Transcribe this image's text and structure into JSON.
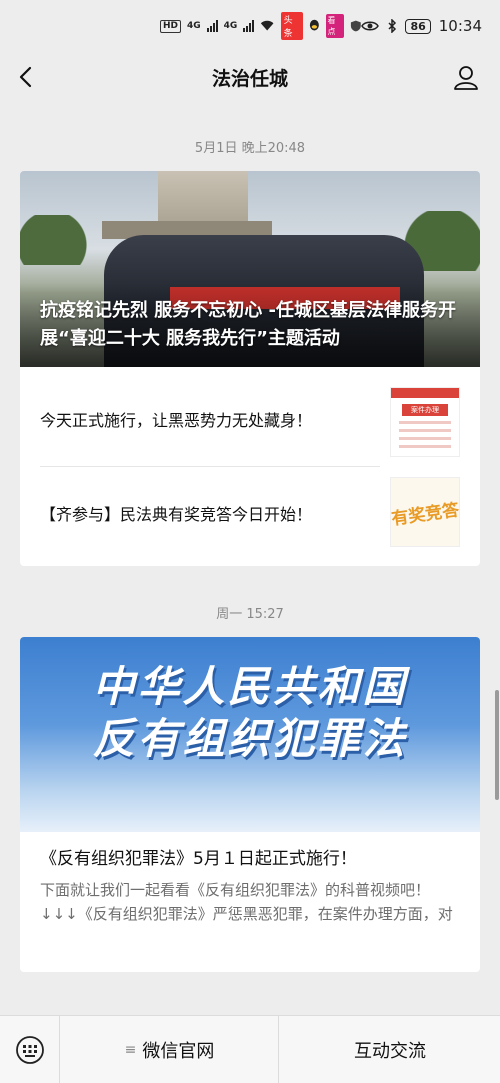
{
  "status_bar": {
    "network_1": "HD",
    "network_2": "4G",
    "network_3": "4G",
    "app_badge_1": "头条",
    "app_badge_2": "看点",
    "battery": "86",
    "time": "10:34"
  },
  "header": {
    "title": "法治任城",
    "back_icon": "chevron-left-icon",
    "profile_icon": "person-icon"
  },
  "feed": [
    {
      "timestamp": "5月1日 晚上20:48",
      "cover_title": "抗疫铭记先烈 服务不忘初心 -任城区基层法律服务开展“喜迎二十大 服务我先行”主题活动",
      "sub_articles": [
        {
          "title": "今天正式施行，让黑恶势力无处藏身！",
          "thumb_text": "案件办理"
        },
        {
          "title": "【齐参与】民法典有奖竞答今日开始！",
          "thumb_text": "有奖竞答"
        }
      ]
    },
    {
      "timestamp": "周一 15:27",
      "cover_line_1": "中华人民共和国",
      "cover_line_2": "反有组织犯罪法",
      "title": "《反有组织犯罪法》5月１日起正式施行！",
      "description": "下面就让我们一起看看《反有组织犯罪法》的科普视频吧！↓↓↓《反有组织犯罪法》严惩黑恶犯罪，在案件办理方面，对"
    }
  ],
  "bottom_menu": {
    "keyboard_icon": "keyboard-icon",
    "item_1": "微信官网",
    "item_1_glyph": "≡",
    "item_2": "互动交流"
  }
}
